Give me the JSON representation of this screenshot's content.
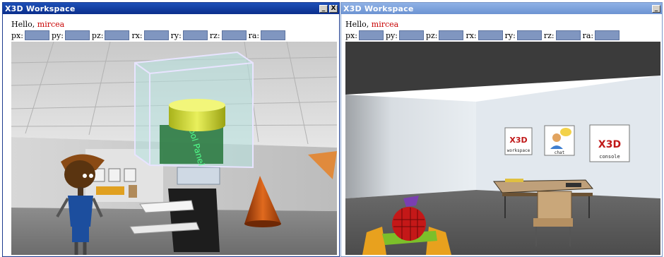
{
  "windows": [
    {
      "title": "X3D Workspace",
      "controls": {
        "minimize": "_",
        "close": "X"
      },
      "greeting": {
        "prefix": "Hello,",
        "user": "mircea"
      },
      "fields": [
        {
          "label": "px:",
          "value": ""
        },
        {
          "label": "py:",
          "value": ""
        },
        {
          "label": "pz:",
          "value": ""
        },
        {
          "label": "rx:",
          "value": ""
        },
        {
          "label": "ry:",
          "value": ""
        },
        {
          "label": "rz:",
          "value": ""
        },
        {
          "label": "ra:",
          "value": ""
        }
      ],
      "scene": {
        "panel_text": "Tool Panel"
      }
    },
    {
      "title": "X3D Workspace",
      "controls": {
        "minimize": "_"
      },
      "greeting": {
        "prefix": "Hello,",
        "user": "mircea"
      },
      "fields": [
        {
          "label": "px:",
          "value": ""
        },
        {
          "label": "py:",
          "value": ""
        },
        {
          "label": "pz:",
          "value": ""
        },
        {
          "label": "rx:",
          "value": ""
        },
        {
          "label": "ry:",
          "value": ""
        },
        {
          "label": "rz:",
          "value": ""
        },
        {
          "label": "ra:",
          "value": ""
        }
      ],
      "scene": {
        "posters": [
          {
            "logo": "X3D",
            "caption": "workspace"
          },
          {
            "logo": "",
            "caption": "chat"
          },
          {
            "logo": "X3D",
            "caption": "console"
          }
        ]
      }
    }
  ]
}
